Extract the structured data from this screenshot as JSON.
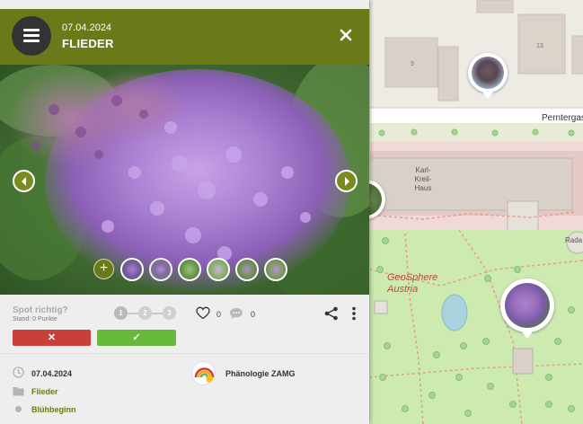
{
  "header": {
    "date": "07.04.2024",
    "title": "FLIEDER"
  },
  "rating": {
    "question": "Spot richtig?",
    "score_label": "Stand: 0 Punkte",
    "steps": [
      "1",
      "2",
      "3"
    ],
    "likes": "0",
    "comments": "0",
    "reject_symbol": "✕",
    "confirm_symbol": "✓"
  },
  "details": {
    "date": "07.04.2024",
    "species": "Flieder",
    "phase": "Blühbeginn",
    "source": "Phänologie ZAMG"
  },
  "map": {
    "street": "Perntergasse",
    "building_karl": "Karl-\nKreil-\nHaus",
    "geo_label": "GeoSphere\nAustria",
    "rada": "Rada",
    "house_9": "9",
    "house_13": "13"
  },
  "colors": {
    "header": "#6b7a18",
    "reject": "#c9403a",
    "confirm": "#68b83c",
    "link": "#6b7a18"
  },
  "icons": {
    "menu": "hamburger-icon",
    "close": "close-icon",
    "prev": "chevron-left-icon",
    "next": "chevron-right-icon",
    "add": "plus-icon",
    "heart": "heart-icon",
    "comment": "comment-icon",
    "share": "share-icon",
    "more": "more-vertical-icon",
    "clock": "clock-icon",
    "folder": "folder-icon",
    "dot": "dot-icon"
  }
}
